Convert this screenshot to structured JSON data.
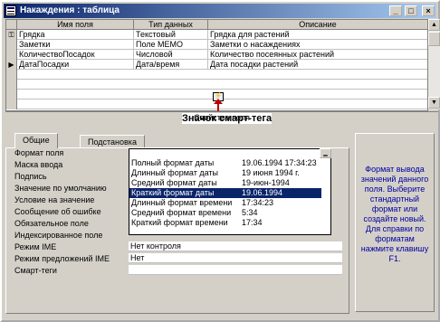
{
  "window": {
    "title": "Накаждения : таблица"
  },
  "grid": {
    "headers": [
      "Имя поля",
      "Тип данных",
      "Описание"
    ],
    "rows": [
      {
        "marker": "⚿",
        "name": "Грядка",
        "type": "Текстовый",
        "desc": "Грядка для растений"
      },
      {
        "marker": "",
        "name": "Заметки",
        "type": "Поле MEMO",
        "desc": "Заметки о насаждениях"
      },
      {
        "marker": "",
        "name": "КоличествоПосадок",
        "type": "Числовой",
        "desc": "Количество посеянных растений"
      },
      {
        "marker": "▶",
        "name": "ДатаПосадки",
        "type": "Дата/время",
        "desc": "Дата посадки растений"
      }
    ]
  },
  "annotation": {
    "label": "Значок смарт-тега"
  },
  "props": {
    "title": "Свойства поля",
    "tabs": [
      "Общие",
      "Подстановка"
    ],
    "labels": [
      "Формат поля",
      "Маска ввода",
      "Подпись",
      "Значение по умолчанию",
      "Условие на значение",
      "Сообщение об ошибке",
      "Обязательное поле",
      "Индексированное поле",
      "Режим IME",
      "Режим предложений IME",
      "Смарт-теги"
    ],
    "values": {
      "ime": "Нет контроля",
      "ime_sentence": "Нет"
    },
    "dropdown": [
      {
        "name": "Полный формат даты",
        "value": "19.06.1994 17:34:23"
      },
      {
        "name": "Длинный формат даты",
        "value": "19 июня 1994 г."
      },
      {
        "name": "Средний формат даты",
        "value": "19-июн-1994"
      },
      {
        "name": "Краткий формат даты",
        "value": "19.06.1994"
      },
      {
        "name": "Длинный формат времени",
        "value": "17:34:23"
      },
      {
        "name": "Средний формат времени",
        "value": "5:34"
      },
      {
        "name": "Краткий формат времени",
        "value": "17:34"
      }
    ],
    "selected_index": 3
  },
  "help": {
    "text": "Формат вывода значений данного поля. Выберите стандартный формат или создайте новый. Для справки по форматам нажмите клавишу F1."
  },
  "colors": {
    "titlebar": "#0a246a",
    "selection": "#0a246a",
    "help_text": "#0000a0",
    "arrow": "#c00000"
  }
}
